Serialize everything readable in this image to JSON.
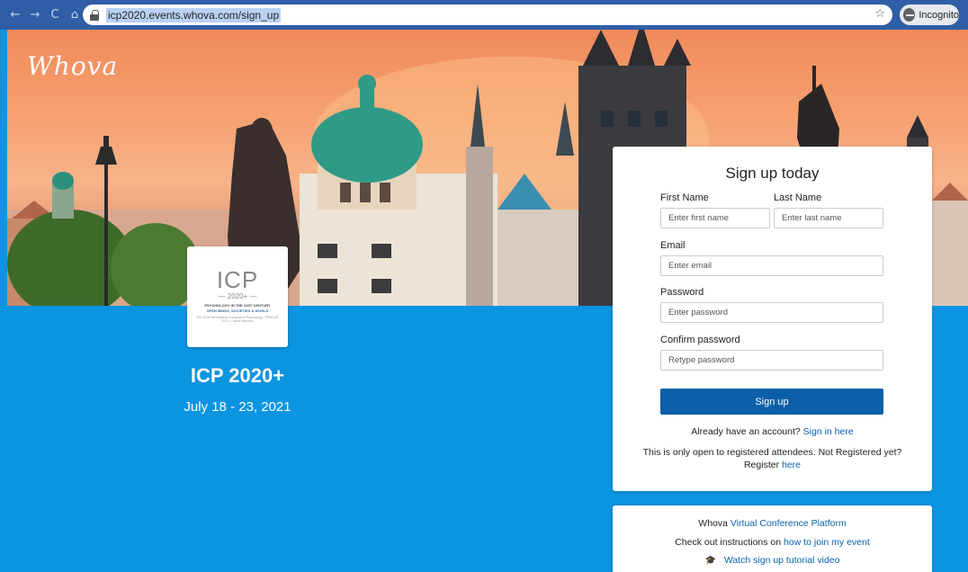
{
  "browser": {
    "url": "icp2020.events.whova.com/sign_up",
    "incognito_label": "Incognito",
    "back_icon": "←",
    "forward_icon": "→",
    "reload_icon": "C",
    "home_icon": "⌂",
    "star_icon": "☆"
  },
  "brand": {
    "name": "Whova"
  },
  "event": {
    "logo_big": "ICP",
    "logo_year": "— 2020+ —",
    "logo_line1": "PSYCHOLOGY IN THE 21ST CENTURY",
    "logo_line2": "OPEN MINDS, SOCIETIES & WORLD",
    "logo_line3": "The 32nd International Congress of Psychology · PRAGUE 2021 | Czech Republic",
    "title": "ICP 2020+",
    "dates": "July 18 - 23, 2021"
  },
  "signup": {
    "heading": "Sign up today",
    "first_name_label": "First Name",
    "first_name_placeholder": "Enter first name",
    "last_name_label": "Last Name",
    "last_name_placeholder": "Enter last name",
    "email_label": "Email",
    "email_placeholder": "Enter email",
    "password_label": "Password",
    "password_placeholder": "Enter password",
    "confirm_label": "Confirm password",
    "confirm_placeholder": "Retype password",
    "button_label": "Sign up",
    "have_account_text": "Already have an account?",
    "sign_in_link": "Sign in here",
    "notice_text": "This is only open to registered attendees. Not Registered yet?",
    "register_text": "Register",
    "register_link": "here"
  },
  "info": {
    "platform_prefix": "Whova",
    "platform_link": "Virtual Conference Platform",
    "instructions_prefix": "Check out instructions on",
    "instructions_link": "how to join my event",
    "video_icon": "🎓",
    "video_link": "Watch sign up tutorial video"
  },
  "colors": {
    "page_bg": "#0b94e0",
    "primary_button": "#0a5fa8",
    "link": "#0a62b0",
    "chrome_bar": "#2f5ea6"
  }
}
